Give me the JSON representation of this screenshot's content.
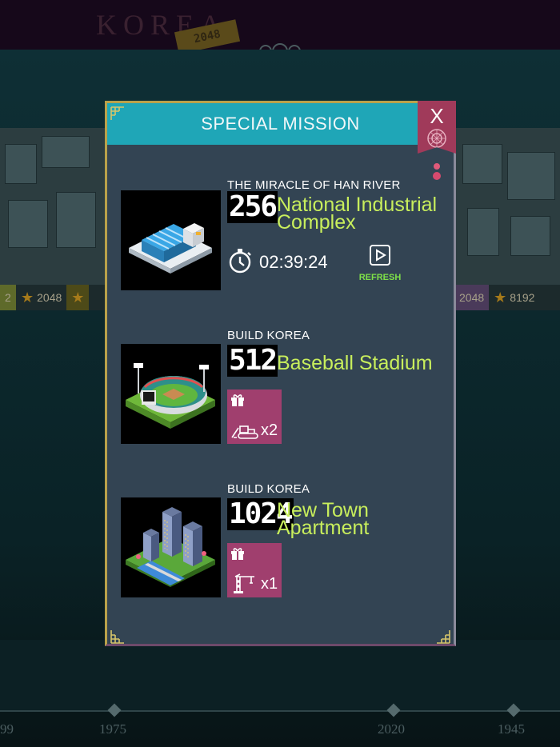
{
  "background": {
    "logo_text": "KOREA",
    "logo_badge": "2048",
    "counters_left": [
      "2",
      "2048"
    ],
    "counters_right": [
      "2048",
      "8192"
    ],
    "timeline_years": [
      "99",
      "1975",
      "2020",
      "1945"
    ]
  },
  "modal": {
    "title": "SPECIAL MISSION",
    "close_label": "X",
    "missions": [
      {
        "category": "THE MIRACLE OF HAN RIVER",
        "tile": "256",
        "name_line1": "National Industrial",
        "name_line2": "Complex",
        "timer": "02:39:24",
        "refresh_label": "REFRESH",
        "thumb_icon": "industrial-complex-icon"
      },
      {
        "category": "BUILD KOREA",
        "tile": "512",
        "name_line1": "Baseball Stadium",
        "name_line2": "",
        "reward_icon": "bulldozer-icon",
        "reward_qty": "x2",
        "thumb_icon": "baseball-stadium-icon"
      },
      {
        "category": "BUILD KOREA",
        "tile": "1024",
        "name_line1": "New Town",
        "name_line2": "Apartment",
        "reward_icon": "crane-icon",
        "reward_qty": "x1",
        "thumb_icon": "new-town-apartment-icon"
      }
    ]
  },
  "colors": {
    "header": "#1fa6b7",
    "panel": "#334453",
    "mission_name": "#c8ee5c",
    "refresh": "#7ee048",
    "reward_bg": "#a03f6e",
    "close_tab": "#a03a5a"
  }
}
